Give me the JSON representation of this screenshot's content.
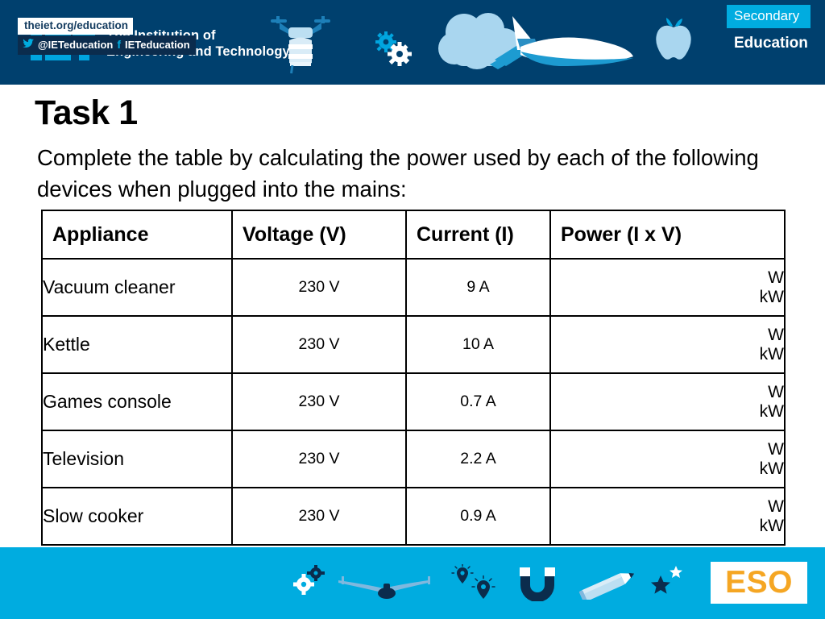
{
  "header": {
    "logo": {
      "mark_alt": "iet-logo-mark",
      "line1": "The Institution of",
      "line2": "Engineering and Technology"
    },
    "badge": {
      "top": "Secondary",
      "bottom": "Education"
    },
    "icons": [
      "drone-icon",
      "gears-icon",
      "cloud-icon",
      "space-shuttle-icon",
      "apple-icon"
    ],
    "bg_color": "#00406e",
    "accent_color": "#00ace0"
  },
  "slide": {
    "title": "Task 1",
    "intro": "Complete the table by calculating the power used by each of the following devices when plugged into the mains:"
  },
  "table": {
    "columns": [
      "Appliance",
      "Voltage (V)",
      "Current (I)",
      "Power (I x V)"
    ],
    "rows": [
      {
        "appliance": "Vacuum cleaner",
        "voltage": "230 V",
        "current": "9 A",
        "power_unit_1": "W",
        "power_unit_2": "kW"
      },
      {
        "appliance": "Kettle",
        "voltage": "230 V",
        "current": "10 A",
        "power_unit_1": "W",
        "power_unit_2": "kW"
      },
      {
        "appliance": "Games console",
        "voltage": "230 V",
        "current": "0.7 A",
        "power_unit_1": "W",
        "power_unit_2": "kW"
      },
      {
        "appliance": "Television",
        "voltage": "230 V",
        "current": "2.2 A",
        "power_unit_1": "W",
        "power_unit_2": "kW"
      },
      {
        "appliance": "Slow cooker",
        "voltage": "230 V",
        "current": "0.9 A",
        "power_unit_1": "W",
        "power_unit_2": "kW"
      }
    ]
  },
  "footer": {
    "url": "theiet.org/education",
    "twitter_handle": "@IETeducation",
    "facebook_handle": "IETeducation",
    "twitter_glyph": "ᵛ",
    "facebook_glyph": "f",
    "logo_text": "ESO",
    "logo_color": "#f5a623",
    "bg_color": "#00ace0",
    "icons": [
      "gears-icon",
      "airplane-icon",
      "location-pin-icon",
      "magnet-icon",
      "pencil-icon",
      "star-icon"
    ]
  }
}
